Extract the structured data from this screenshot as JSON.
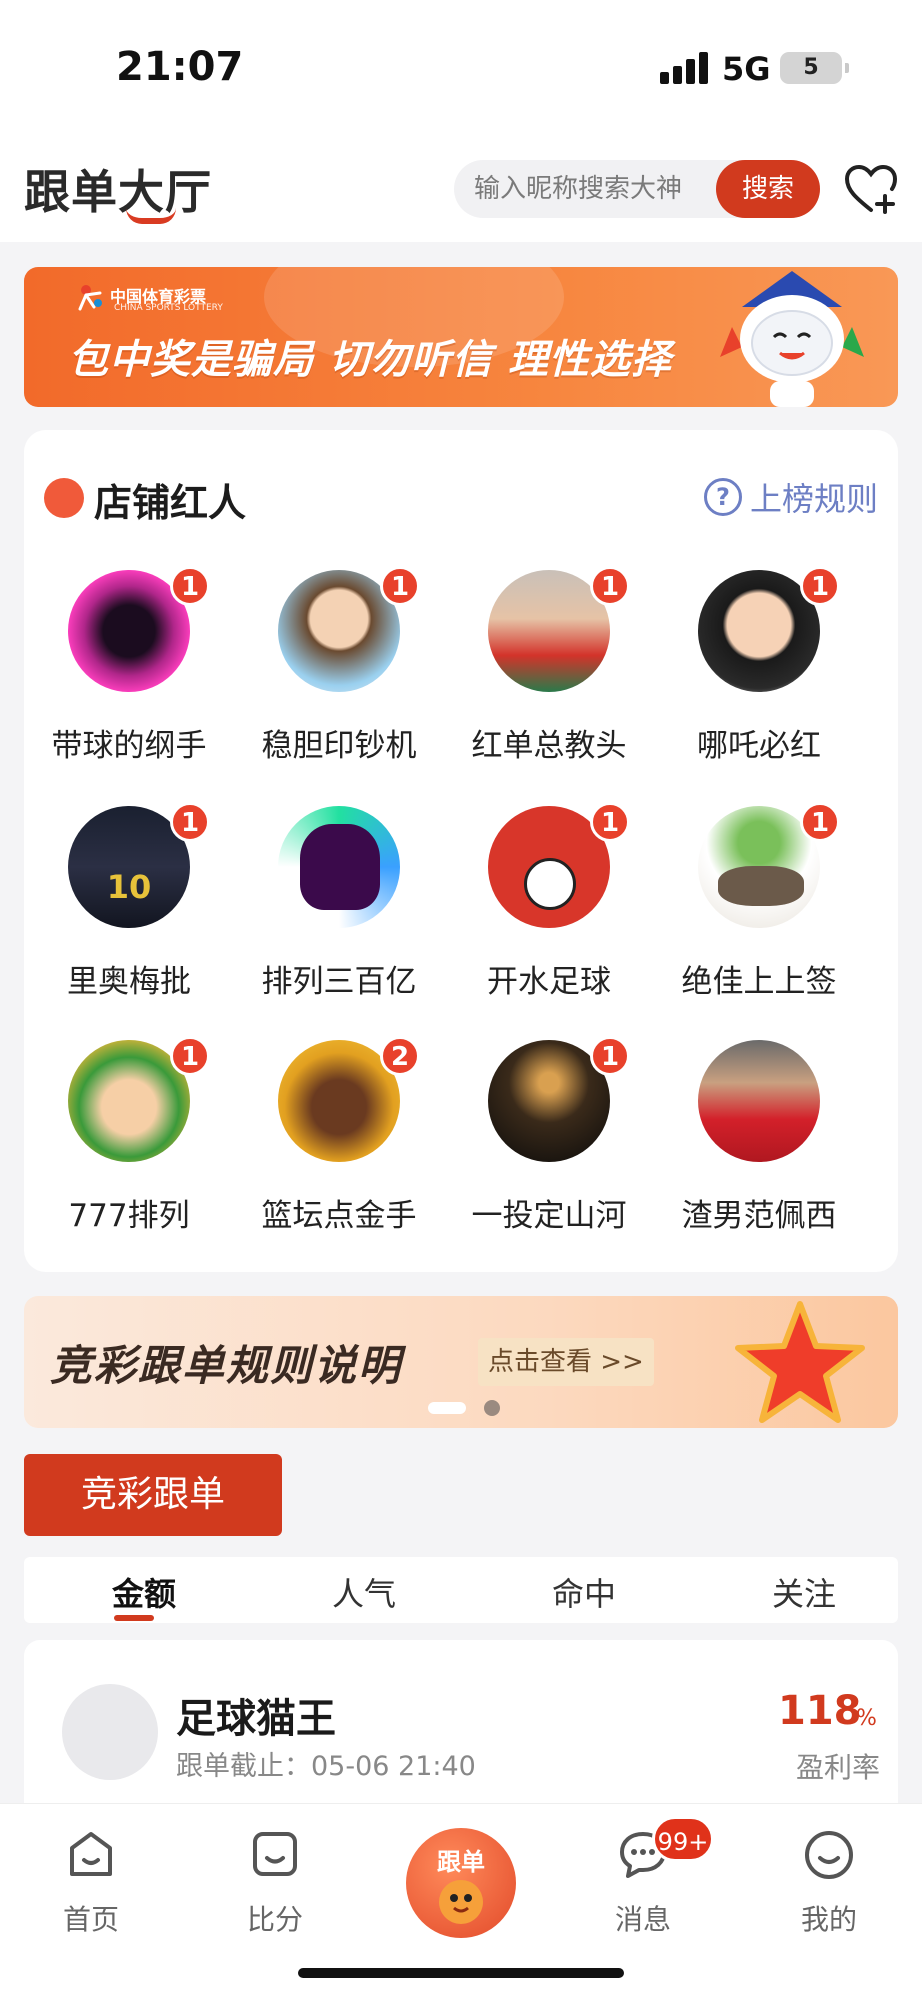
{
  "status_bar": {
    "time": "21:07",
    "network": "5G",
    "battery": "5"
  },
  "header": {
    "logo": "跟单大厅",
    "search_placeholder": "输入昵称搜索大神",
    "search_button": "搜索"
  },
  "banner": {
    "brand_cn": "中国体育彩票",
    "brand_en": "CHINA SPORTS LOTTERY",
    "slogan": "包中奖是骗局 切勿听信 理性选择"
  },
  "experts_card": {
    "title": "店铺红人",
    "rules_link": "上榜规则",
    "experts": [
      {
        "name": "带球的纲手",
        "badge": "1"
      },
      {
        "name": "稳胆印钞机",
        "badge": "1"
      },
      {
        "name": "红单总教头",
        "badge": "1"
      },
      {
        "name": "哪吒必红",
        "badge": "1"
      },
      {
        "name": "里奥梅批",
        "badge": "1"
      },
      {
        "name": "排列三百亿",
        "badge": ""
      },
      {
        "name": "开水足球",
        "badge": "1"
      },
      {
        "name": "绝佳上上签",
        "badge": "1"
      },
      {
        "name": "777排列",
        "badge": "1"
      },
      {
        "name": "篮坛点金手",
        "badge": "2"
      },
      {
        "name": "一投定山河",
        "badge": "1"
      },
      {
        "name": "渣男范佩西",
        "badge": ""
      }
    ]
  },
  "rule_banner": {
    "title": "竞彩跟单规则说明",
    "button": "点击查看 >>"
  },
  "section_button": "竞彩跟单",
  "tabs": [
    "金额",
    "人气",
    "命中",
    "关注"
  ],
  "list": [
    {
      "name": "足球猫王",
      "deadline": "跟单截止：05-06 21:40",
      "rate": "118",
      "rate_unit": "%",
      "rate_label": "盈利率"
    }
  ],
  "tabbar": {
    "items": [
      "首页",
      "比分",
      "跟单",
      "消息",
      "我的"
    ],
    "message_badge": "99+"
  },
  "colors": {
    "accent": "#d13a1e",
    "badge": "#e8412b",
    "link": "#6d7fc4"
  }
}
